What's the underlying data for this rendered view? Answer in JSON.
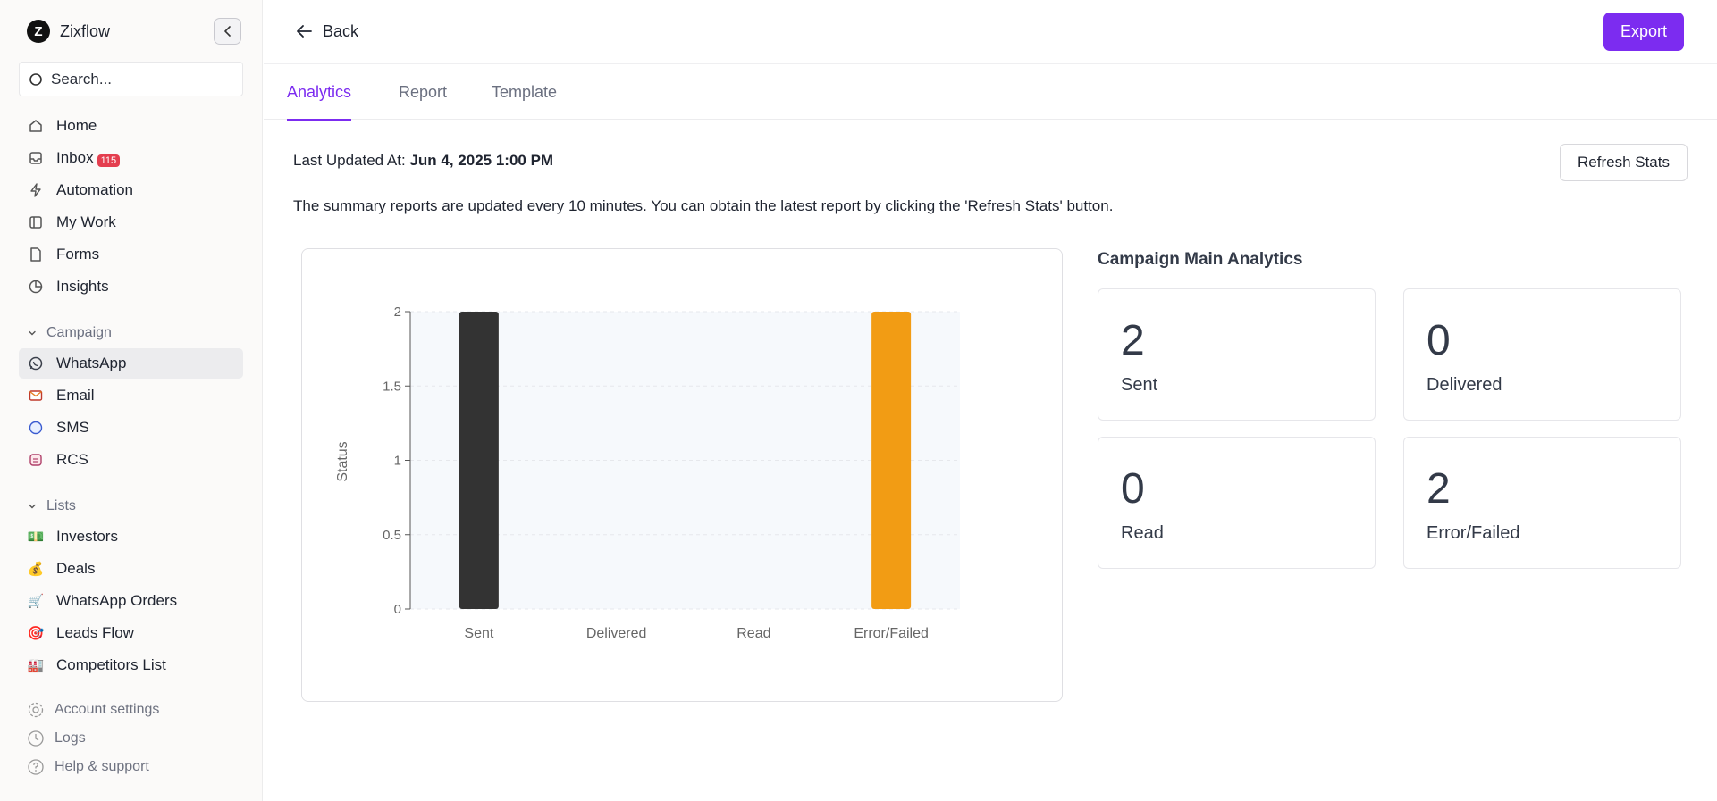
{
  "brand": {
    "name": "Zixflow",
    "logo_letter": "Z"
  },
  "search": {
    "placeholder": "Search..."
  },
  "nav": {
    "home": "Home",
    "inbox": "Inbox",
    "inbox_badge": "115",
    "automation": "Automation",
    "my_work": "My Work",
    "forms": "Forms",
    "insights": "Insights"
  },
  "campaign": {
    "header": "Campaign",
    "items": [
      "WhatsApp",
      "Email",
      "SMS",
      "RCS"
    ],
    "active": "WhatsApp"
  },
  "lists": {
    "header": "Lists",
    "items": [
      {
        "icon": "💵",
        "label": "Investors"
      },
      {
        "icon": "💰",
        "label": "Deals"
      },
      {
        "icon": "🛒",
        "label": "WhatsApp Orders"
      },
      {
        "icon": "🎯",
        "label": "Leads Flow"
      },
      {
        "icon": "🏭",
        "label": "Competitors List"
      }
    ]
  },
  "footer": {
    "account_settings": "Account settings",
    "logs": "Logs",
    "help": "Help & support"
  },
  "topbar": {
    "back_label": "Back",
    "export_label": "Export"
  },
  "tabs": [
    "Analytics",
    "Report",
    "Template"
  ],
  "active_tab": "Analytics",
  "updated": {
    "label": "Last Updated At:",
    "value": "Jun 4, 2025 1:00 PM"
  },
  "refresh_label": "Refresh Stats",
  "summary_text": "The summary reports are updated every 10 minutes. You can obtain the latest report by clicking the 'Refresh Stats' button.",
  "analytics": {
    "title": "Campaign Main Analytics",
    "stats": [
      {
        "value": "2",
        "label": "Sent"
      },
      {
        "value": "0",
        "label": "Delivered"
      },
      {
        "value": "0",
        "label": "Read"
      },
      {
        "value": "2",
        "label": "Error/Failed"
      }
    ]
  },
  "colors": {
    "accent": "#7c2cf0",
    "sent_bar": "#333333",
    "failed_bar": "#f29c14",
    "badge": "#e43e4f"
  },
  "chart_data": {
    "type": "bar",
    "categories": [
      "Sent",
      "Delivered",
      "Read",
      "Error/Failed"
    ],
    "values": [
      2,
      0,
      0,
      2
    ],
    "bar_colors": [
      "#333333",
      "#333333",
      "#333333",
      "#f29c14"
    ],
    "ylabel": "Status",
    "xlabel": "",
    "ylim": [
      0,
      2
    ],
    "yticks": [
      "0",
      "0.5",
      "1",
      "1.5",
      "2"
    ],
    "grid": true
  }
}
